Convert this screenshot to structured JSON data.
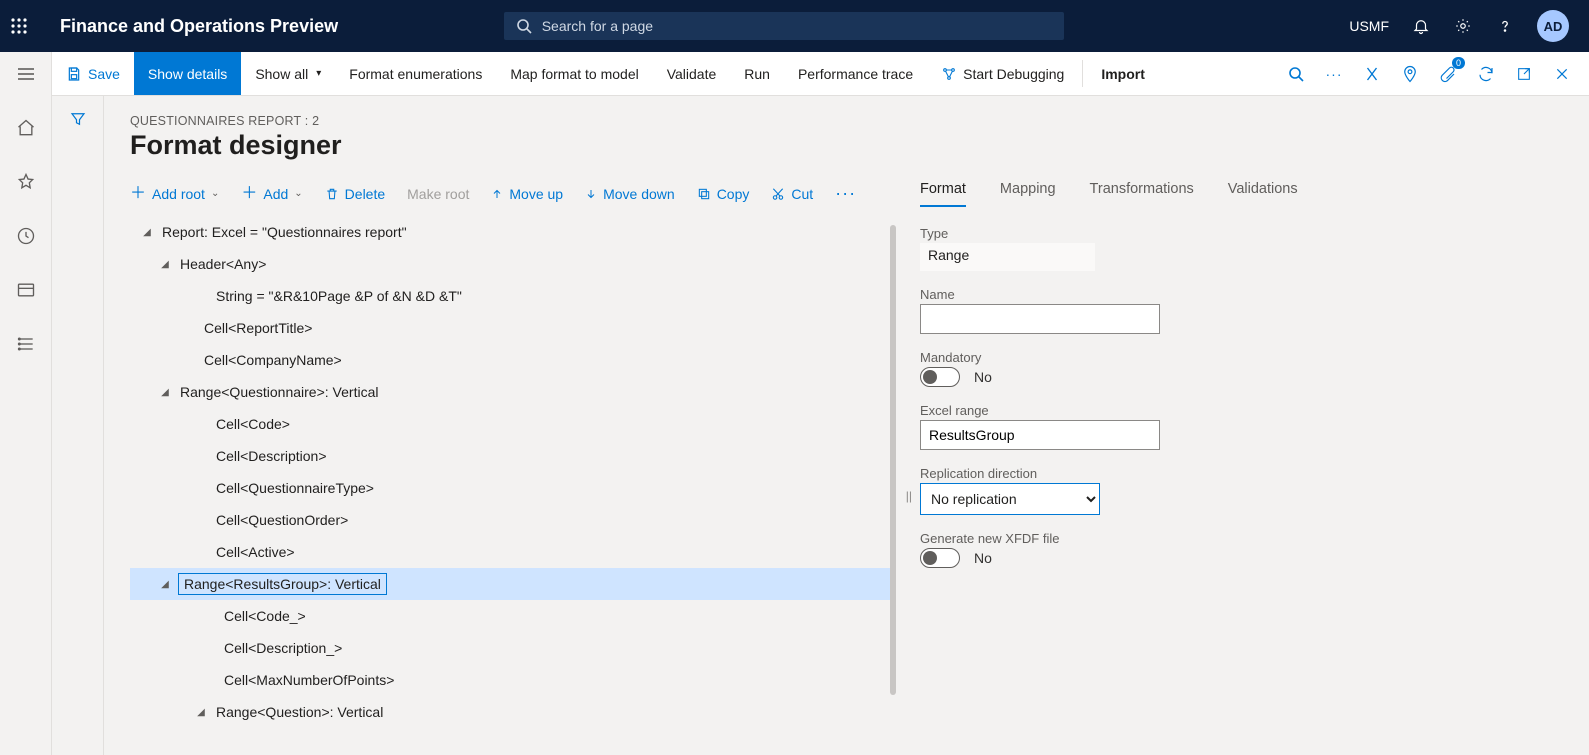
{
  "header": {
    "app_title": "Finance and Operations Preview",
    "search_placeholder": "Search for a page",
    "company": "USMF",
    "avatar_initials": "AD"
  },
  "commandbar": {
    "save": "Save",
    "show_details": "Show details",
    "show_all": "Show all",
    "format_enum": "Format enumerations",
    "map_format": "Map format to model",
    "validate": "Validate",
    "run": "Run",
    "perf_trace": "Performance trace",
    "start_debug": "Start Debugging",
    "import": "Import",
    "attach_count": "0"
  },
  "page": {
    "breadcrumb": "QUESTIONNAIRES REPORT : 2",
    "title": "Format designer"
  },
  "treebar": {
    "add_root": "Add root",
    "add": "Add",
    "delete": "Delete",
    "make_root": "Make root",
    "move_up": "Move up",
    "move_down": "Move down",
    "copy": "Copy",
    "cut": "Cut"
  },
  "tree": {
    "n0": "Report: Excel = \"Questionnaires report\"",
    "n1": "Header<Any>",
    "n2": "String = \"&R&10Page &P of &N &D &T\"",
    "n3": "Cell<ReportTitle>",
    "n4": "Cell<CompanyName>",
    "n5": "Range<Questionnaire>: Vertical",
    "n6": "Cell<Code>",
    "n7": "Cell<Description>",
    "n8": "Cell<QuestionnaireType>",
    "n9": "Cell<QuestionOrder>",
    "n10": "Cell<Active>",
    "n11": "Range<ResultsGroup>: Vertical",
    "n12": "Cell<Code_>",
    "n13": "Cell<Description_>",
    "n14": "Cell<MaxNumberOfPoints>",
    "n15": "Range<Question>: Vertical"
  },
  "tabs": {
    "format": "Format",
    "mapping": "Mapping",
    "transformations": "Transformations",
    "validations": "Validations"
  },
  "form": {
    "type_label": "Type",
    "type_value": "Range",
    "name_label": "Name",
    "name_value": "",
    "mandatory_label": "Mandatory",
    "mandatory_value": "No",
    "excel_range_label": "Excel range",
    "excel_range_value": "ResultsGroup",
    "repl_dir_label": "Replication direction",
    "repl_dir_value": "No replication",
    "gen_xfdf_label": "Generate new XFDF file",
    "gen_xfdf_value": "No"
  }
}
